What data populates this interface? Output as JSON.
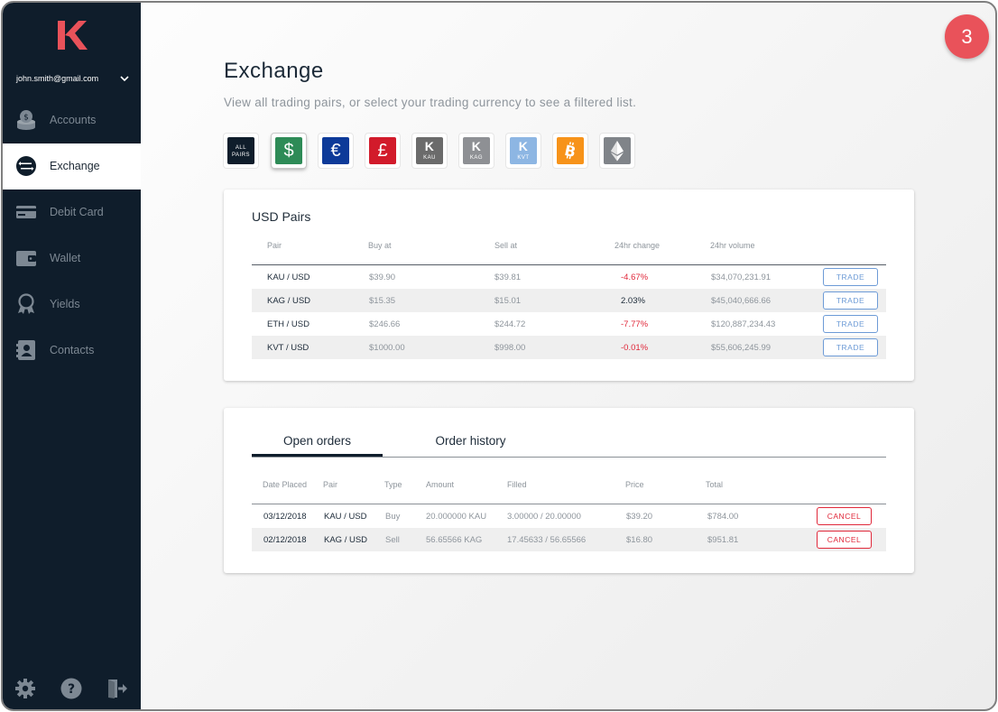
{
  "sidebar": {
    "logo_letter": "K",
    "user_email": "john.smith@gmail.com",
    "items": [
      {
        "label": "Accounts",
        "icon": "coins-icon"
      },
      {
        "label": "Exchange",
        "icon": "exchange-icon",
        "active": true
      },
      {
        "label": "Debit Card",
        "icon": "card-icon"
      },
      {
        "label": "Wallet",
        "icon": "wallet-icon"
      },
      {
        "label": "Yields",
        "icon": "award-icon"
      },
      {
        "label": "Contacts",
        "icon": "contacts-icon"
      }
    ],
    "bottom_icons": [
      "gear-icon",
      "help-icon",
      "logout-icon"
    ]
  },
  "header": {
    "title": "Exchange",
    "subtitle": "View all trading pairs, or select your trading currency to see a filtered list.",
    "step_badge": "3"
  },
  "currency_filters": [
    {
      "label_line1": "ALL",
      "label_line2": "PAIRS",
      "color": "#0f1d2b"
    },
    {
      "symbol": "$",
      "color": "#2e8b57",
      "selected": true
    },
    {
      "symbol": "€",
      "color": "#0d3a99"
    },
    {
      "symbol": "£",
      "color": "#d21b2b"
    },
    {
      "symbol": "K",
      "sub": "KAU",
      "color": "#6b6b6b"
    },
    {
      "symbol": "K",
      "sub": "KAG",
      "color": "#8e9094"
    },
    {
      "symbol": "K",
      "sub": "KVT",
      "color": "#8db6e3"
    },
    {
      "symbol": "B",
      "color": "#f7931a"
    },
    {
      "symbol": "ETH",
      "color": "#808489"
    }
  ],
  "pairs_card": {
    "title": "USD Pairs",
    "headers": {
      "pair": "Pair",
      "buy": "Buy at",
      "sell": "Sell at",
      "change": "24hr change",
      "volume": "24hr volume"
    },
    "trade_label": "TRADE",
    "rows": [
      {
        "pair": "KAU / USD",
        "buy": "$39.90",
        "sell": "$39.81",
        "change": "-4.67%",
        "volume": "$34,070,231.91"
      },
      {
        "pair": "KAG / USD",
        "buy": "$15.35",
        "sell": "$15.01",
        "change": "2.03%",
        "volume": "$45,040,666.66"
      },
      {
        "pair": "ETH / USD",
        "buy": "$246.66",
        "sell": "$244.72",
        "change": "-7.77%",
        "volume": "$120,887,234.43"
      },
      {
        "pair": "KVT / USD",
        "buy": "$1000.00",
        "sell": "$998.00",
        "change": "-0.01%",
        "volume": "$55,606,245.99"
      }
    ]
  },
  "orders_card": {
    "tabs": [
      {
        "label": "Open orders",
        "active": true
      },
      {
        "label": "Order history"
      }
    ],
    "headers": {
      "date": "Date Placed",
      "pair": "Pair",
      "type": "Type",
      "amount": "Amount",
      "filled": "Filled",
      "price": "Price",
      "total": "Total"
    },
    "cancel_label": "CANCEL",
    "rows": [
      {
        "date": "03/12/2018",
        "pair": "KAU / USD",
        "type": "Buy",
        "amount": "20.000000 KAU",
        "filled": "3.00000 / 20.00000",
        "price": "$39.20",
        "total": "$784.00"
      },
      {
        "date": "02/12/2018",
        "pair": "KAG / USD",
        "type": "Sell",
        "amount": "56.65566 KAG",
        "filled": "17.45633 / 56.65566",
        "price": "$16.80",
        "total": "$951.81"
      }
    ]
  },
  "colors": {
    "sidebar_bg": "#0f1d2b",
    "accent_red": "#e9525a",
    "negative": "#e0283a",
    "trade_blue": "#6d9bd6"
  }
}
